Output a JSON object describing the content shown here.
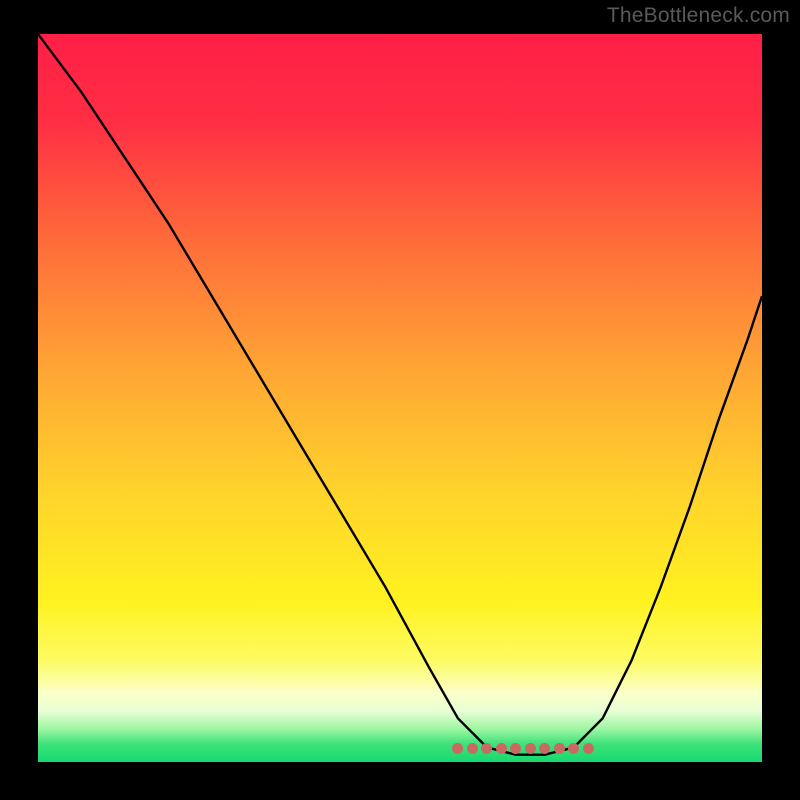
{
  "watermark": "TheBottleneck.com",
  "chart_data": {
    "type": "line",
    "title": "",
    "xlabel": "",
    "ylabel": "",
    "xlim": [
      0,
      100
    ],
    "ylim": [
      0,
      100
    ],
    "gradient_stops": [
      {
        "offset": 0.0,
        "color": "#ff1f46"
      },
      {
        "offset": 0.12,
        "color": "#ff2e44"
      },
      {
        "offset": 0.28,
        "color": "#ff6a3a"
      },
      {
        "offset": 0.45,
        "color": "#ffa235"
      },
      {
        "offset": 0.62,
        "color": "#ffd12c"
      },
      {
        "offset": 0.78,
        "color": "#fff220"
      },
      {
        "offset": 0.86,
        "color": "#fdfb62"
      },
      {
        "offset": 0.905,
        "color": "#fbffc8"
      },
      {
        "offset": 0.93,
        "color": "#e8ffd5"
      },
      {
        "offset": 0.955,
        "color": "#9cf6a1"
      },
      {
        "offset": 0.975,
        "color": "#3fe27b"
      },
      {
        "offset": 1.0,
        "color": "#14d96e"
      }
    ],
    "series": [
      {
        "name": "bottleneck-curve",
        "x": [
          0,
          6,
          12,
          18,
          24,
          30,
          36,
          42,
          48,
          54,
          58,
          62,
          66,
          70,
          74,
          78,
          82,
          86,
          90,
          94,
          98,
          100
        ],
        "y": [
          100,
          92,
          83,
          74,
          64,
          54,
          44,
          34,
          24,
          13,
          6,
          2,
          1,
          1,
          2,
          6,
          14,
          24,
          35,
          47,
          58,
          64
        ]
      }
    ],
    "flat_region": {
      "x_start": 58,
      "x_end": 76,
      "y": 1.8
    },
    "marker_points_x": [
      58,
      60,
      62,
      64,
      66,
      68,
      70,
      72,
      74,
      76
    ]
  }
}
